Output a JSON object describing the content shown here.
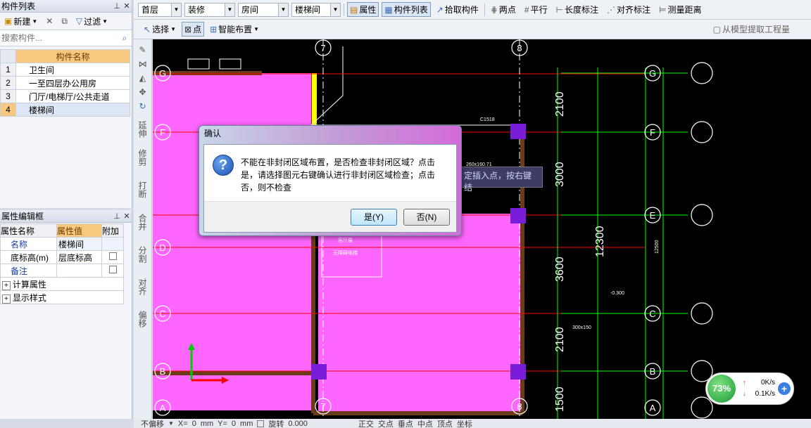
{
  "comp_panel": {
    "title": "构件列表",
    "new_label": "新建",
    "filter_label": "过滤",
    "search_placeholder": "搜索构件...",
    "col_header": "构件名称",
    "rows": [
      {
        "n": "1",
        "name": "卫生间"
      },
      {
        "n": "2",
        "name": "一至四层办公用房"
      },
      {
        "n": "3",
        "name": "门厅/电梯厅/公共走道"
      },
      {
        "n": "4",
        "name": "楼梯间"
      }
    ]
  },
  "prop_panel": {
    "title": "属性编辑框",
    "h_name": "属性名称",
    "h_value": "属性值",
    "h_extra": "附加",
    "rows": [
      {
        "name": "名称",
        "value": "楼梯间"
      },
      {
        "name": "底标高(m)",
        "value": "层底标高"
      },
      {
        "name": "备注",
        "value": ""
      }
    ],
    "groups": [
      "计算属性",
      "显示样式"
    ]
  },
  "toolbar1": {
    "floor": "首层",
    "category": "装修",
    "type": "房间",
    "item": "楼梯间",
    "attr": "属性",
    "complist": "构件列表",
    "pick": "拾取构件",
    "twopoint": "两点",
    "parallel": "平行",
    "len_mark": "长度标注",
    "align_mark": "对齐标注",
    "measure": "测量距离"
  },
  "toolbar2": {
    "select": "选择",
    "point": "点",
    "smart": "智能布置",
    "extract": "从模型提取工程量"
  },
  "vtools": [
    "延伸",
    "修剪",
    "打断",
    "合并",
    "分割",
    "对齐",
    "偏移"
  ],
  "cad": {
    "axis_labels": [
      "7",
      "8",
      "7",
      "8"
    ],
    "row_labels_left": [
      "G",
      "F",
      "E",
      "D",
      "C",
      "B",
      "A"
    ],
    "dims": [
      "2100",
      "3000",
      "3600",
      "2100",
      "1500",
      "12300"
    ],
    "small_labels": [
      "C1518",
      "260x160.71",
      "-0.300",
      "300x150",
      "12500",
      "客厅展",
      "无障碍电梯"
    ],
    "tooltip": "定插入点，按右键结"
  },
  "dialog": {
    "title": "确认",
    "message": "不能在非封闭区域布置，是否检查非封闭区域？点击是，请选择图元右键确认进行非封闭区域检查；点击否，则不检查",
    "yes": "是(Y)",
    "no": "否(N)"
  },
  "status": {
    "mode": "不偏移",
    "x": "X=",
    "xv": "0",
    "mm1": "mm",
    "y": "Y=",
    "yv": "0",
    "mm2": "mm",
    "rotate": "旋转",
    "rv": "0.000",
    "ortho": "正交",
    "snap": "交点",
    "mid": "垂点",
    "center": "中点",
    "vertex": "顶点",
    "coord": "坐标"
  },
  "net": {
    "pct": "73%",
    "up": "0K/s",
    "down": "0.1K/s"
  }
}
